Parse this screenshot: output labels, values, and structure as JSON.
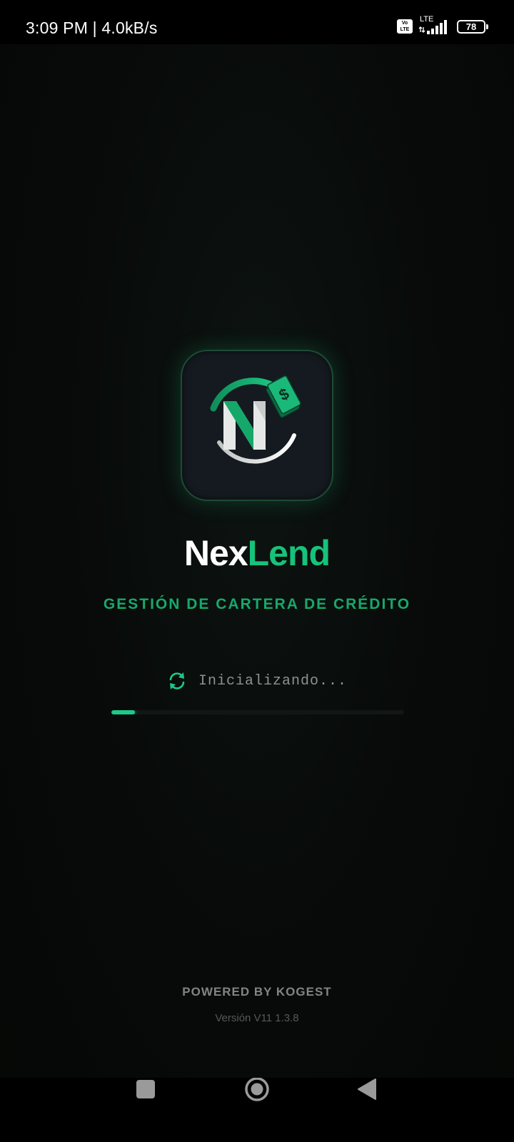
{
  "status_bar": {
    "time_speed": "3:09 PM | 4.0kB/s",
    "volte_top": "Vo",
    "volte_bottom": "LTE",
    "network": "LTE",
    "battery": "78",
    "icons": [
      "volte-icon",
      "signal-icon",
      "battery-icon"
    ]
  },
  "app": {
    "name_part1": "Nex",
    "name_part2": "Lend",
    "tagline": "GESTIÓN DE CARTERA DE CRÉDITO",
    "logo_icon": "nexlend-logo-icon"
  },
  "loading": {
    "icon": "sync-icon",
    "text": "Inicializando...",
    "progress_fraction": 0.08
  },
  "footer": {
    "powered_by": "POWERED BY KOGEST",
    "version": "Versión V11 1.3.8"
  },
  "nav": {
    "icons": [
      "recent-apps-icon",
      "home-icon",
      "back-icon"
    ]
  },
  "colors": {
    "accent": "#17c27a",
    "background": "#070908",
    "logo_box": "#141a1f",
    "text_muted": "#8b9290"
  }
}
